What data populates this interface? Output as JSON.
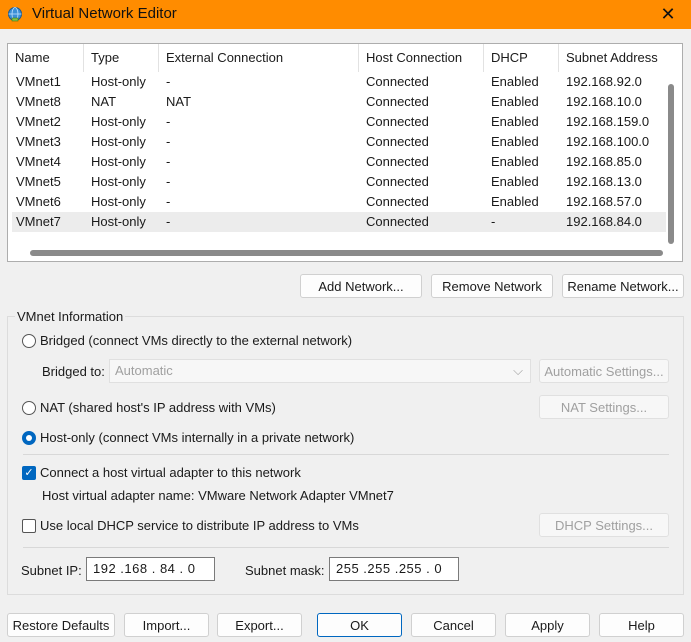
{
  "window": {
    "title": "Virtual Network Editor",
    "close": "✕"
  },
  "table": {
    "columns": [
      "Name",
      "Type",
      "External Connection",
      "Host Connection",
      "DHCP",
      "Subnet Address"
    ],
    "rows": [
      [
        "VMnet1",
        "Host-only",
        "-",
        "Connected",
        "Enabled",
        "192.168.92.0"
      ],
      [
        "VMnet8",
        "NAT",
        "NAT",
        "Connected",
        "Enabled",
        "192.168.10.0"
      ],
      [
        "VMnet2",
        "Host-only",
        "-",
        "Connected",
        "Enabled",
        "192.168.159.0"
      ],
      [
        "VMnet3",
        "Host-only",
        "-",
        "Connected",
        "Enabled",
        "192.168.100.0"
      ],
      [
        "VMnet4",
        "Host-only",
        "-",
        "Connected",
        "Enabled",
        "192.168.85.0"
      ],
      [
        "VMnet5",
        "Host-only",
        "-",
        "Connected",
        "Enabled",
        "192.168.13.0"
      ],
      [
        "VMnet6",
        "Host-only",
        "-",
        "Connected",
        "Enabled",
        "192.168.57.0"
      ],
      [
        "VMnet7",
        "Host-only",
        "-",
        "Connected",
        "-",
        "192.168.84.0"
      ]
    ],
    "selected_row": "VMnet7"
  },
  "network_buttons": {
    "add": "Add Network...",
    "remove": "Remove Network",
    "rename": "Rename Network..."
  },
  "vmnet_info": {
    "group_title": "VMnet Information",
    "bridged_label": "Bridged (connect VMs directly to the external network)",
    "bridged_to_label": "Bridged to:",
    "bridged_to_value": "Automatic",
    "automatic_settings": "Automatic Settings...",
    "nat_label": "NAT (shared host's IP address with VMs)",
    "nat_settings": "NAT Settings...",
    "hostonly_label": "Host-only (connect VMs internally in a private network)",
    "selected_mode": "Host-only",
    "connect_adapter_label": "Connect a host virtual adapter to this network",
    "connect_adapter_checked": true,
    "adapter_name_text": "Host virtual adapter name: VMware Network Adapter VMnet7",
    "dhcp_label": "Use local DHCP service to distribute IP address to VMs",
    "dhcp_checked": false,
    "dhcp_settings": "DHCP Settings...",
    "subnet_ip_label": "Subnet IP:",
    "subnet_ip_value": "192 .168 . 84 .  0",
    "subnet_mask_label": "Subnet mask:",
    "subnet_mask_value": "255 .255 .255 .  0"
  },
  "footer_buttons": {
    "restore": "Restore Defaults",
    "import": "Import...",
    "export": "Export...",
    "ok": "OK",
    "cancel": "Cancel",
    "apply": "Apply",
    "help": "Help"
  },
  "colors": {
    "titlebar": "#ff8c00",
    "accent": "#0067c0"
  }
}
